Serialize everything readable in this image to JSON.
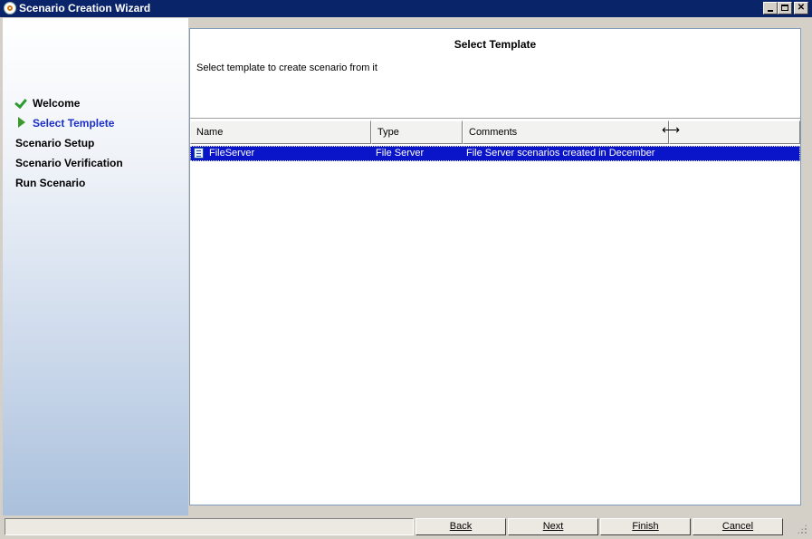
{
  "window": {
    "title": "Scenario Creation Wizard",
    "icon": "app-icon",
    "controls": [
      "minimize",
      "maximize",
      "close"
    ]
  },
  "nav": {
    "items": [
      {
        "label": "Welcome",
        "state": "completed",
        "icon": "check-icon"
      },
      {
        "label": "Select Templete",
        "state": "current",
        "icon": "arrow-right-icon"
      },
      {
        "label": "Scenario Setup",
        "state": "pending"
      },
      {
        "label": "Scenario Verification",
        "state": "pending"
      },
      {
        "label": "Run Scenario",
        "state": "pending"
      }
    ]
  },
  "header": {
    "title": "Select Template",
    "description": "Select template to create scenario from it"
  },
  "table": {
    "columns": [
      "Name",
      "Type",
      "Comments",
      ""
    ],
    "rows": [
      {
        "name": "FileServer",
        "type": "File Server",
        "comments": "File Server scenarios created in December",
        "selected": true,
        "icon": "template-icon"
      }
    ]
  },
  "buttons": {
    "back": "Back",
    "next": "Next",
    "finish": "Finish",
    "cancel": "Cancel"
  },
  "colors": {
    "titlebar": "#0a246a",
    "selection": "#0a14c8",
    "current_step": "#1a2ec8",
    "check": "#2f9a2f"
  }
}
